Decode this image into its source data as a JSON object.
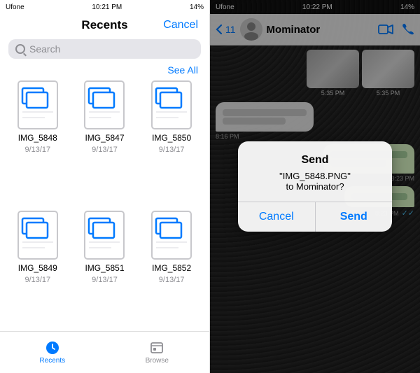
{
  "left": {
    "status": {
      "carrier": "Ufone",
      "time": "10:21 PM",
      "battery": "14%"
    },
    "header": {
      "title": "Recents",
      "cancel_label": "Cancel"
    },
    "search": {
      "placeholder": "Search"
    },
    "see_all": "See All",
    "files": [
      {
        "name": "IMG_5848",
        "date": "9/13/17"
      },
      {
        "name": "IMG_5847",
        "date": "9/13/17"
      },
      {
        "name": "IMG_5850",
        "date": "9/13/17"
      },
      {
        "name": "IMG_5849",
        "date": "9/13/17"
      },
      {
        "name": "IMG_5851",
        "date": "9/13/17"
      },
      {
        "name": "IMG_5852",
        "date": "9/13/17"
      }
    ],
    "tabs": [
      {
        "label": "Recents",
        "active": true
      },
      {
        "label": "Browse",
        "active": false
      }
    ]
  },
  "right": {
    "status": {
      "carrier": "Ufone",
      "time": "10:22 PM",
      "battery": "14%"
    },
    "header": {
      "back_count": "11",
      "contact_name": "Mominator"
    },
    "messages": [
      {
        "time": "5:35 PM",
        "type": "image-row"
      },
      {
        "time": "8:16 PM",
        "type": "received"
      },
      {
        "time": "8:23 PM",
        "type": "sent"
      },
      {
        "time": "8:23 PM",
        "type": "sent"
      }
    ],
    "dialog": {
      "title": "Send",
      "file_name": "\"IMG_5848.PNG\"",
      "recipient": "to Mominator?",
      "cancel_label": "Cancel",
      "send_label": "Send"
    }
  }
}
